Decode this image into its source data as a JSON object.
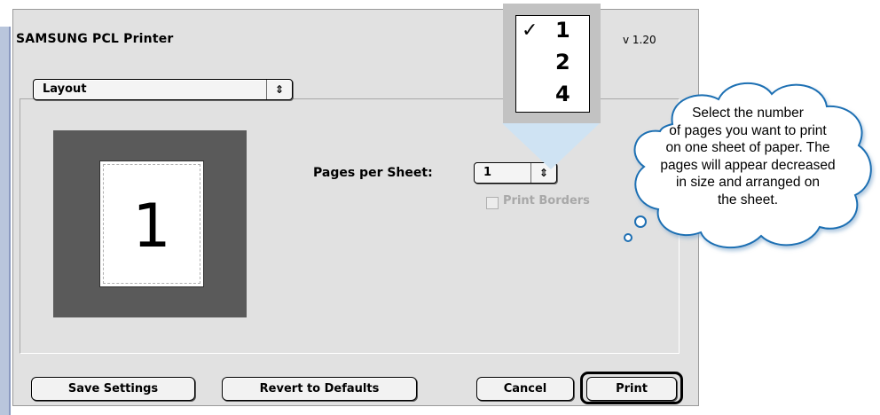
{
  "dialog": {
    "title": "SAMSUNG PCL Printer",
    "version": "v 1.20"
  },
  "layout_popup": {
    "value": "Layout",
    "arrows": "⇕"
  },
  "preview": {
    "page_number": "1"
  },
  "pages_per_sheet": {
    "label": "Pages per Sheet:",
    "value": "1",
    "arrows": "⇕"
  },
  "print_borders": {
    "label": "Print Borders",
    "checked": false,
    "enabled": false
  },
  "menu": {
    "items": [
      {
        "check": "✓",
        "value": "1"
      },
      {
        "check": "",
        "value": "2"
      },
      {
        "check": "",
        "value": "4"
      }
    ]
  },
  "callout": {
    "lines": [
      "Select the number",
      "of pages you want to print",
      "on one sheet of paper. The",
      "pages will appear decreased",
      "in size and arranged on",
      "the sheet."
    ]
  },
  "buttons": {
    "save": "Save Settings",
    "revert": "Revert to Defaults",
    "cancel": "Cancel",
    "print": "Print"
  },
  "colors": {
    "callout_border": "#1e6fb3",
    "beam": "#cfe3f3",
    "left_strip": "#b9c6dc"
  }
}
